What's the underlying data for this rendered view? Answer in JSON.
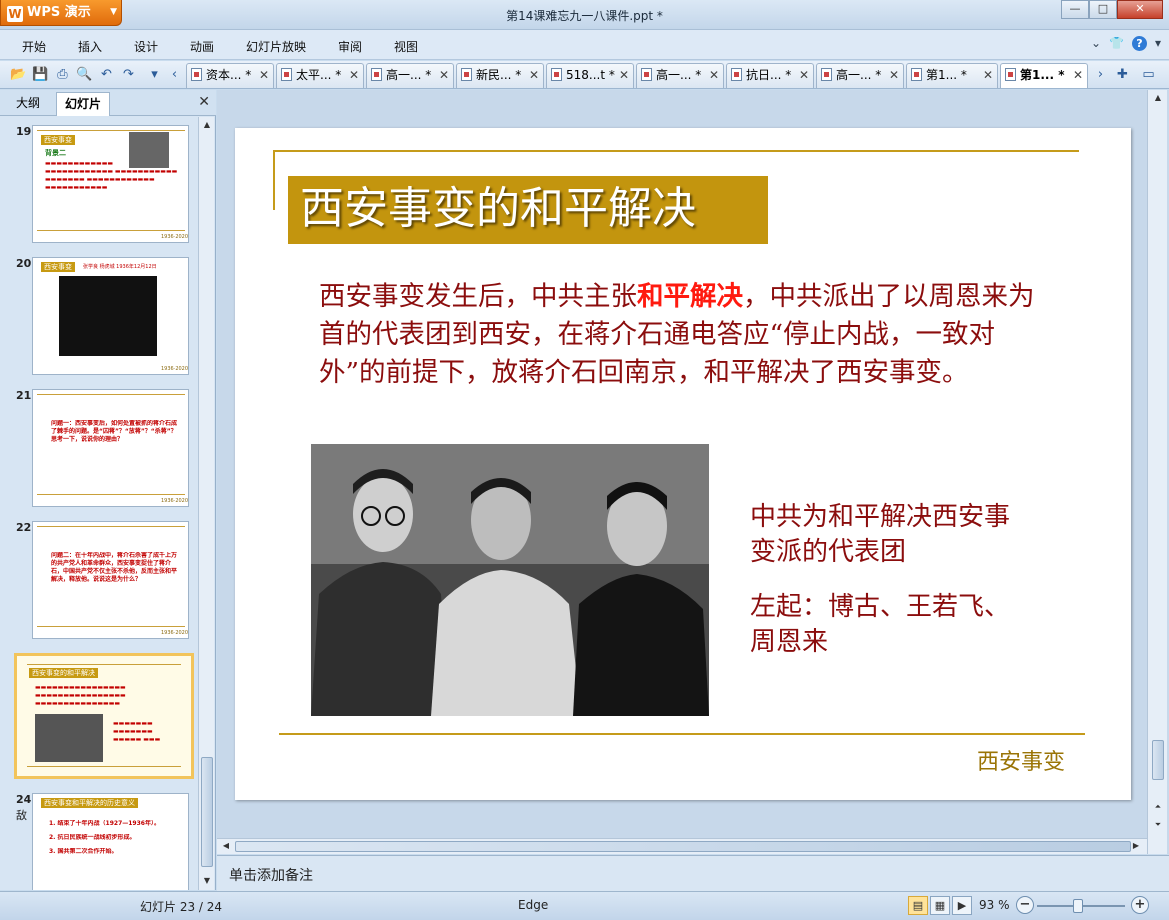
{
  "app": {
    "name": "WPS 演示",
    "window_title": "第14课难忘九一八课件.ppt *"
  },
  "menu": [
    "开始",
    "插入",
    "设计",
    "动画",
    "幻灯片放映",
    "审阅",
    "视图"
  ],
  "tabs": [
    {
      "label": "资本... *"
    },
    {
      "label": "太平... *"
    },
    {
      "label": "高一... *"
    },
    {
      "label": "新民... *"
    },
    {
      "label": "518...t *"
    },
    {
      "label": "高一... *"
    },
    {
      "label": "抗日... *"
    },
    {
      "label": "高一... *"
    },
    {
      "label": "第1... *"
    },
    {
      "label": "第1... *",
      "active": true
    }
  ],
  "panel": {
    "tab_outline": "大纲",
    "tab_slides": "幻灯片"
  },
  "thumbnails": [
    {
      "number": "19",
      "title": "西安事变",
      "subtitle": "背景二",
      "footer": "1936·2020"
    },
    {
      "number": "20",
      "title": "西安事变",
      "subtitle": "张学良 杨虎城 1936年12月12日",
      "footer": "1936·2020"
    },
    {
      "number": "21",
      "title": "",
      "subtitle": "问题一：西安事变后，如何处置被抓的蒋介石成了棘手的问题。是“囚蒋”？“放蒋”？“杀蒋”？思考一下，说说你的理由？",
      "footer": "1936·2020"
    },
    {
      "number": "22",
      "title": "",
      "subtitle": "问题二：在十年内战中，蒋介石杀害了成千上万的共产党人和革命群众，西安事变捉住了蒋介石，中国共产党不仅主张不杀他，反而主张和平解决，释放他。说说这是为什么？",
      "footer": "1936·2020"
    },
    {
      "number": "23",
      "title": "西安事变的和平解决",
      "subtitle": "",
      "footer": "",
      "selected": true
    },
    {
      "number": "24",
      "extra": "敌",
      "title": "西安事变和平解决的历史意义",
      "subtitle": "",
      "footer": "",
      "items": [
        "1. 结束了十年内战（1927—1936年）。",
        "2. 抗日民族统一战线初步形成。",
        "3. 国共第二次合作开始。"
      ]
    }
  ],
  "slide": {
    "title": "西安事变的和平解决",
    "body_before": "西安事变发生后，中共主张",
    "body_highlight": "和平解决",
    "body_after": "，中共派出了以周恩来为首的代表团到西安，在蒋介石通电答应“停止内战，一致对外”的前提下，放蒋介石回南京，和平解决了西安事变。",
    "caption_1": "中共为和平解决西安事变派的代表团",
    "caption_2": "左起：博古、王若飞、周恩来",
    "footer": "西安事变"
  },
  "notes": {
    "placeholder": "单击添加备注"
  },
  "status": {
    "slide_indicator": "幻灯片 23 / 24",
    "theme": "Edge",
    "zoom": "93 %"
  },
  "colors": {
    "accent_gold": "#c3950e",
    "body_text": "#8b0d0d",
    "highlight": "#ff1a0f",
    "app_orange": "#e06b0c"
  }
}
